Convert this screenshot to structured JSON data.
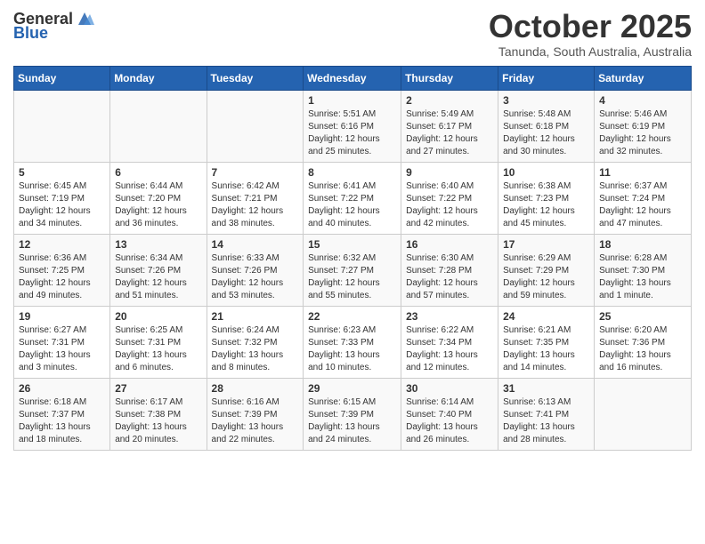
{
  "header": {
    "logo_general": "General",
    "logo_blue": "Blue",
    "month_title": "October 2025",
    "subtitle": "Tanunda, South Australia, Australia"
  },
  "days_of_week": [
    "Sunday",
    "Monday",
    "Tuesday",
    "Wednesday",
    "Thursday",
    "Friday",
    "Saturday"
  ],
  "weeks": [
    [
      {
        "day": "",
        "info": ""
      },
      {
        "day": "",
        "info": ""
      },
      {
        "day": "",
        "info": ""
      },
      {
        "day": "1",
        "info": "Sunrise: 5:51 AM\nSunset: 6:16 PM\nDaylight: 12 hours\nand 25 minutes."
      },
      {
        "day": "2",
        "info": "Sunrise: 5:49 AM\nSunset: 6:17 PM\nDaylight: 12 hours\nand 27 minutes."
      },
      {
        "day": "3",
        "info": "Sunrise: 5:48 AM\nSunset: 6:18 PM\nDaylight: 12 hours\nand 30 minutes."
      },
      {
        "day": "4",
        "info": "Sunrise: 5:46 AM\nSunset: 6:19 PM\nDaylight: 12 hours\nand 32 minutes."
      }
    ],
    [
      {
        "day": "5",
        "info": "Sunrise: 6:45 AM\nSunset: 7:19 PM\nDaylight: 12 hours\nand 34 minutes."
      },
      {
        "day": "6",
        "info": "Sunrise: 6:44 AM\nSunset: 7:20 PM\nDaylight: 12 hours\nand 36 minutes."
      },
      {
        "day": "7",
        "info": "Sunrise: 6:42 AM\nSunset: 7:21 PM\nDaylight: 12 hours\nand 38 minutes."
      },
      {
        "day": "8",
        "info": "Sunrise: 6:41 AM\nSunset: 7:22 PM\nDaylight: 12 hours\nand 40 minutes."
      },
      {
        "day": "9",
        "info": "Sunrise: 6:40 AM\nSunset: 7:22 PM\nDaylight: 12 hours\nand 42 minutes."
      },
      {
        "day": "10",
        "info": "Sunrise: 6:38 AM\nSunset: 7:23 PM\nDaylight: 12 hours\nand 45 minutes."
      },
      {
        "day": "11",
        "info": "Sunrise: 6:37 AM\nSunset: 7:24 PM\nDaylight: 12 hours\nand 47 minutes."
      }
    ],
    [
      {
        "day": "12",
        "info": "Sunrise: 6:36 AM\nSunset: 7:25 PM\nDaylight: 12 hours\nand 49 minutes."
      },
      {
        "day": "13",
        "info": "Sunrise: 6:34 AM\nSunset: 7:26 PM\nDaylight: 12 hours\nand 51 minutes."
      },
      {
        "day": "14",
        "info": "Sunrise: 6:33 AM\nSunset: 7:26 PM\nDaylight: 12 hours\nand 53 minutes."
      },
      {
        "day": "15",
        "info": "Sunrise: 6:32 AM\nSunset: 7:27 PM\nDaylight: 12 hours\nand 55 minutes."
      },
      {
        "day": "16",
        "info": "Sunrise: 6:30 AM\nSunset: 7:28 PM\nDaylight: 12 hours\nand 57 minutes."
      },
      {
        "day": "17",
        "info": "Sunrise: 6:29 AM\nSunset: 7:29 PM\nDaylight: 12 hours\nand 59 minutes."
      },
      {
        "day": "18",
        "info": "Sunrise: 6:28 AM\nSunset: 7:30 PM\nDaylight: 13 hours\nand 1 minute."
      }
    ],
    [
      {
        "day": "19",
        "info": "Sunrise: 6:27 AM\nSunset: 7:31 PM\nDaylight: 13 hours\nand 3 minutes."
      },
      {
        "day": "20",
        "info": "Sunrise: 6:25 AM\nSunset: 7:31 PM\nDaylight: 13 hours\nand 6 minutes."
      },
      {
        "day": "21",
        "info": "Sunrise: 6:24 AM\nSunset: 7:32 PM\nDaylight: 13 hours\nand 8 minutes."
      },
      {
        "day": "22",
        "info": "Sunrise: 6:23 AM\nSunset: 7:33 PM\nDaylight: 13 hours\nand 10 minutes."
      },
      {
        "day": "23",
        "info": "Sunrise: 6:22 AM\nSunset: 7:34 PM\nDaylight: 13 hours\nand 12 minutes."
      },
      {
        "day": "24",
        "info": "Sunrise: 6:21 AM\nSunset: 7:35 PM\nDaylight: 13 hours\nand 14 minutes."
      },
      {
        "day": "25",
        "info": "Sunrise: 6:20 AM\nSunset: 7:36 PM\nDaylight: 13 hours\nand 16 minutes."
      }
    ],
    [
      {
        "day": "26",
        "info": "Sunrise: 6:18 AM\nSunset: 7:37 PM\nDaylight: 13 hours\nand 18 minutes."
      },
      {
        "day": "27",
        "info": "Sunrise: 6:17 AM\nSunset: 7:38 PM\nDaylight: 13 hours\nand 20 minutes."
      },
      {
        "day": "28",
        "info": "Sunrise: 6:16 AM\nSunset: 7:39 PM\nDaylight: 13 hours\nand 22 minutes."
      },
      {
        "day": "29",
        "info": "Sunrise: 6:15 AM\nSunset: 7:39 PM\nDaylight: 13 hours\nand 24 minutes."
      },
      {
        "day": "30",
        "info": "Sunrise: 6:14 AM\nSunset: 7:40 PM\nDaylight: 13 hours\nand 26 minutes."
      },
      {
        "day": "31",
        "info": "Sunrise: 6:13 AM\nSunset: 7:41 PM\nDaylight: 13 hours\nand 28 minutes."
      },
      {
        "day": "",
        "info": ""
      }
    ]
  ]
}
